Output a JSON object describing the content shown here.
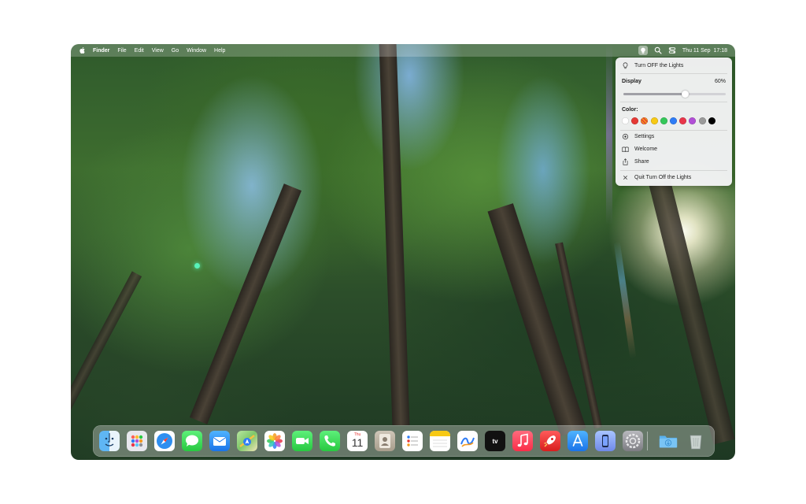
{
  "menubar": {
    "apple_icon": "apple-icon",
    "app_name": "Finder",
    "items": [
      "File",
      "Edit",
      "View",
      "Go",
      "Window",
      "Help"
    ],
    "clock": "Thu 11 Sep  17:18"
  },
  "popup": {
    "toggle_label": "Turn OFF the Lights",
    "display_label": "Display",
    "display_value": "60%",
    "display_level": 0.6,
    "color_label": "Color:",
    "colors": [
      "#ffffff",
      "#e53935",
      "#f59a1f",
      "#f7c914",
      "#34c759",
      "#2e7cf6",
      "#e8364a",
      "#b14fd6",
      "#9a9a9a",
      "#000000"
    ],
    "settings_label": "Settings",
    "welcome_label": "Welcome",
    "share_label": "Share",
    "quit_label": "Quit Turn Off the Lights"
  },
  "dock": {
    "apps": [
      "finder",
      "launchpad",
      "safari",
      "messages",
      "mail",
      "maps",
      "photos",
      "facetime",
      "phone",
      "calendar",
      "contacts",
      "reminders",
      "notes",
      "freeform",
      "tv",
      "music",
      "rocket",
      "app-store",
      "iphone-mirroring",
      "system-settings"
    ],
    "calendar_day_name": "Thu",
    "calendar_day": "11",
    "tv_label": "tv",
    "folder": "downloads-folder",
    "trash": "trash"
  }
}
